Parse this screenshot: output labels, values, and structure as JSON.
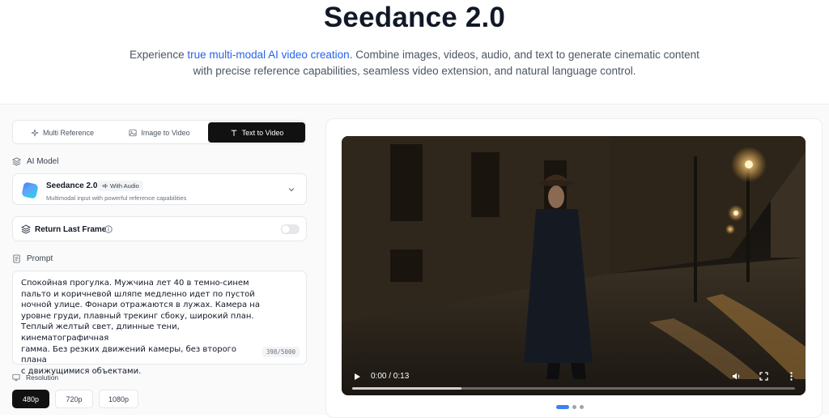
{
  "hero": {
    "title": "Seedance 2.0",
    "desc_pre": "Experience ",
    "desc_accent": "true multi-modal AI video creation",
    "desc_post": ". Combine images, videos, audio, and text to generate cinematic content with precise reference capabilities, seamless video extension, and natural language control."
  },
  "tabs": [
    {
      "label": "Multi Reference",
      "icon": "sparkle-icon"
    },
    {
      "label": "Image to Video",
      "icon": "image-icon"
    },
    {
      "label": "Text to Video",
      "icon": "text-icon",
      "active": true
    }
  ],
  "ai_model": {
    "section_label": "AI Model",
    "name": "Seedance 2.0",
    "badge": "With Audio",
    "subtitle": "Multimodal input with powerful reference capabilities"
  },
  "return_last_frame": {
    "label": "Return Last Frame",
    "enabled": false
  },
  "prompt": {
    "section_label": "Prompt",
    "text": "Спокойная прогулка. Мужчина лет 40 в темно-синем\nпальто и коричневой шляпе медленно идет по пустой\nночной улице. Фонари отражаются в лужах. Камера на\nуровне груди, плавный трекинг сбоку, широкий план.\nТеплый желтый свет, длинные тени, кинематографичная\nгамма. Без резких движений камеры, без второго плана\nс движущимися объектами.",
    "counter": "398/5000"
  },
  "resolution": {
    "section_label": "Resolution",
    "options": [
      "480p",
      "720p",
      "1080p"
    ],
    "selected": "480p"
  },
  "video": {
    "time": "0:00 / 0:13",
    "progress": 0
  },
  "carousel": {
    "count": 3,
    "active_index": 0
  },
  "colors": {
    "accent": "#2563eb",
    "active_tab": "#111111",
    "carousel_active": "#3b82f6"
  }
}
